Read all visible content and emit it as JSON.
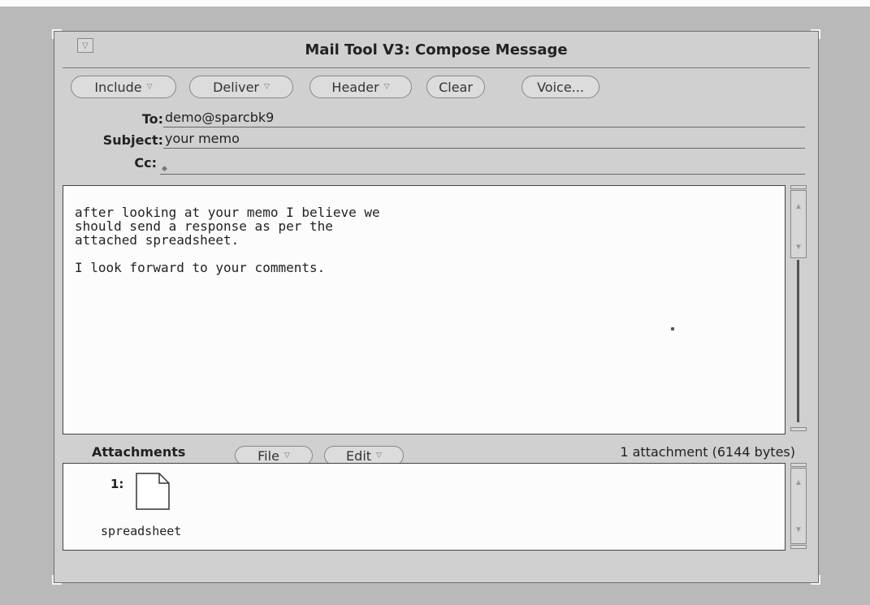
{
  "window": {
    "title": "Mail Tool V3: Compose Message",
    "menu_glyph": "▽"
  },
  "toolbar": {
    "include_label": "Include",
    "deliver_label": "Deliver",
    "header_label": "Header",
    "clear_label": "Clear",
    "voice_label": "Voice...",
    "menu_glyph": "▽"
  },
  "header": {
    "to_label": "To:",
    "to_value": "demo@sparcbk9",
    "subject_label": "Subject:",
    "subject_value": "your memo",
    "cc_label": "Cc:",
    "cc_value": "",
    "caret_glyph": "◆"
  },
  "message": {
    "body": "after looking at your memo I believe we\nshould send a response as per the\nattached spreadsheet.\n\nI look forward to your comments."
  },
  "attachments": {
    "label": "Attachments",
    "file_label": "File",
    "edit_label": "Edit",
    "status": "1 attachment (6144 bytes)",
    "items": [
      {
        "index": "1:",
        "name": "spreadsheet",
        "icon": "document-icon"
      }
    ]
  },
  "scroll": {
    "up_glyph": "▲",
    "down_glyph": "▼"
  },
  "colors": {
    "desktop": "#b9b9b9",
    "window": "#d0d0d0",
    "pane": "#fcfcfc"
  }
}
